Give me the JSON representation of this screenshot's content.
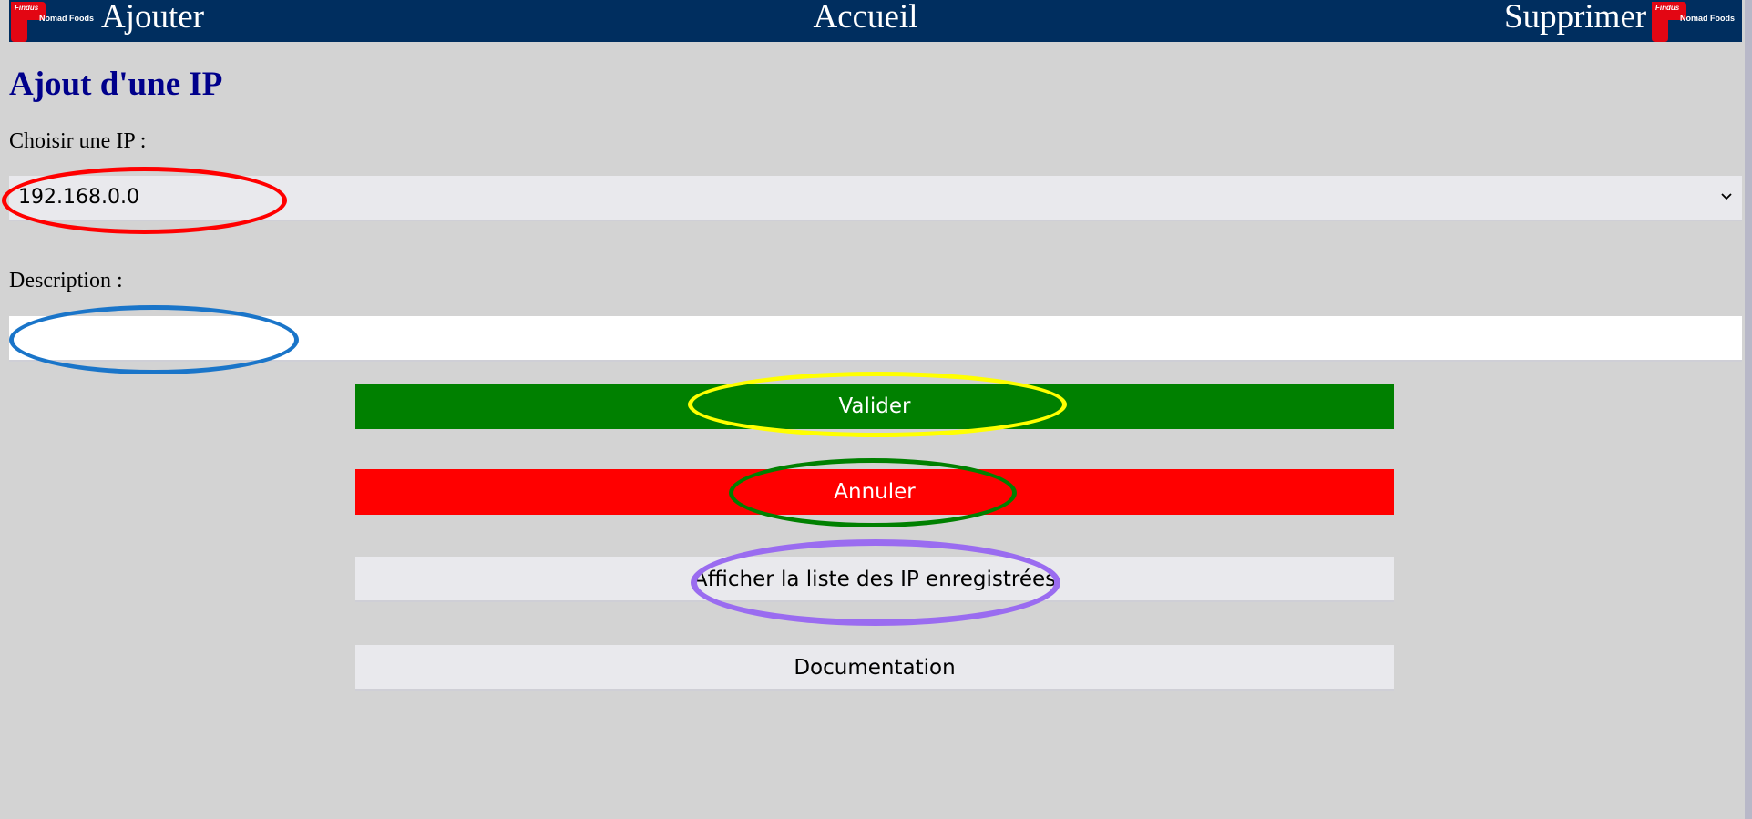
{
  "nav": {
    "add_label": "Ajouter",
    "home_label": "Accueil",
    "delete_label": "Supprimer",
    "logo": {
      "brand_text": "Findus",
      "company_text": "Nomad Foods"
    },
    "background_color": "#002e5f"
  },
  "page": {
    "title": "Ajout d'une IP",
    "title_color": "#00008b",
    "background_color": "#d3d3d3"
  },
  "form": {
    "ip_label": "Choisir une IP :",
    "ip_selected": "192.168.0.0",
    "description_label": "Description :",
    "description_value": ""
  },
  "buttons": {
    "validate_label": "Valider",
    "cancel_label": "Annuler",
    "list_label": "Afficher la liste des IP enregistrées",
    "documentation_label": "Documentation",
    "validate_color": "#008000",
    "cancel_color": "#ff0000"
  },
  "annotations": [
    {
      "target": "ip-select",
      "color": "#ff0000"
    },
    {
      "target": "description-input",
      "color": "#1a75c9"
    },
    {
      "target": "validate-button",
      "color": "#ffff00"
    },
    {
      "target": "cancel-button",
      "color": "#008000"
    },
    {
      "target": "list-ip-button",
      "color": "#9a6cf0"
    }
  ]
}
